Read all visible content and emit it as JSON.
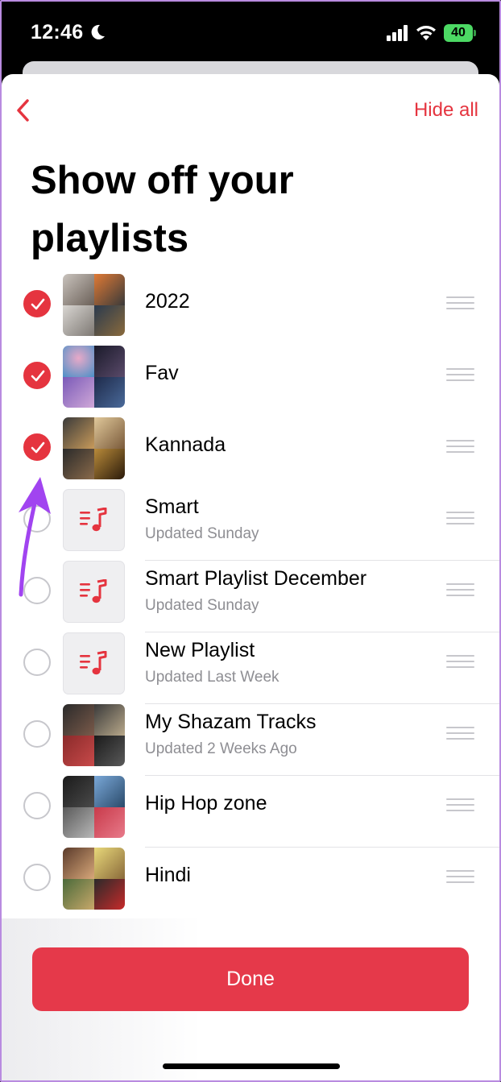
{
  "status_bar": {
    "time": "12:46",
    "battery": "40",
    "icons": [
      "moon-icon",
      "signal-icon",
      "wifi-icon",
      "battery-icon"
    ]
  },
  "header": {
    "back_icon": "chevron-left-icon",
    "hide_all_label": "Hide all",
    "title": "Show off your playlists"
  },
  "colors": {
    "accent": "#e5343f",
    "done": "#e5394a",
    "annotation_arrow": "#a144f0"
  },
  "playlists": [
    {
      "title": "2022",
      "subtitle": "",
      "checked": true,
      "artwork": "mosaic"
    },
    {
      "title": "Fav",
      "subtitle": "",
      "checked": true,
      "artwork": "mosaic"
    },
    {
      "title": "Kannada",
      "subtitle": "",
      "checked": true,
      "artwork": "mosaic"
    },
    {
      "title": "Smart",
      "subtitle": "Updated Sunday",
      "checked": false,
      "artwork": "music-note-list-icon"
    },
    {
      "title": "Smart Playlist December",
      "subtitle": "Updated Sunday",
      "checked": false,
      "artwork": "music-note-list-icon"
    },
    {
      "title": "New Playlist",
      "subtitle": "Updated Last Week",
      "checked": false,
      "artwork": "music-note-list-icon"
    },
    {
      "title": "My Shazam Tracks",
      "subtitle": "Updated 2 Weeks Ago",
      "checked": false,
      "artwork": "mosaic"
    },
    {
      "title": "Hip Hop zone",
      "subtitle": "",
      "checked": false,
      "artwork": "mosaic"
    },
    {
      "title": "Hindi",
      "subtitle": "",
      "checked": false,
      "artwork": "mosaic"
    }
  ],
  "footer": {
    "done_label": "Done"
  }
}
